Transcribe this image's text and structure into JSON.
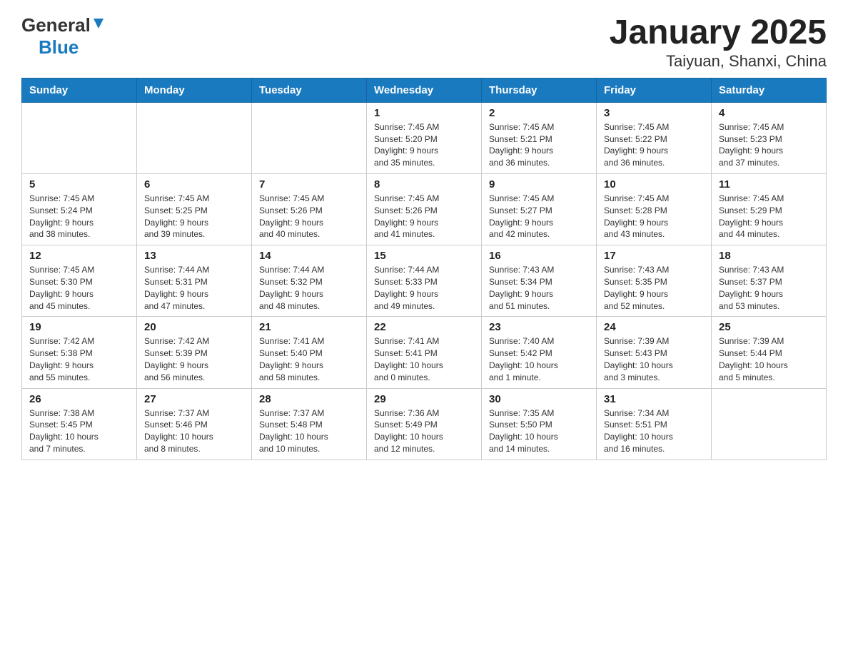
{
  "header": {
    "logo_general": "General",
    "logo_blue": "Blue",
    "title": "January 2025",
    "subtitle": "Taiyuan, Shanxi, China"
  },
  "weekdays": [
    "Sunday",
    "Monday",
    "Tuesday",
    "Wednesday",
    "Thursday",
    "Friday",
    "Saturday"
  ],
  "weeks": [
    [
      {
        "day": "",
        "info": ""
      },
      {
        "day": "",
        "info": ""
      },
      {
        "day": "",
        "info": ""
      },
      {
        "day": "1",
        "info": "Sunrise: 7:45 AM\nSunset: 5:20 PM\nDaylight: 9 hours\nand 35 minutes."
      },
      {
        "day": "2",
        "info": "Sunrise: 7:45 AM\nSunset: 5:21 PM\nDaylight: 9 hours\nand 36 minutes."
      },
      {
        "day": "3",
        "info": "Sunrise: 7:45 AM\nSunset: 5:22 PM\nDaylight: 9 hours\nand 36 minutes."
      },
      {
        "day": "4",
        "info": "Sunrise: 7:45 AM\nSunset: 5:23 PM\nDaylight: 9 hours\nand 37 minutes."
      }
    ],
    [
      {
        "day": "5",
        "info": "Sunrise: 7:45 AM\nSunset: 5:24 PM\nDaylight: 9 hours\nand 38 minutes."
      },
      {
        "day": "6",
        "info": "Sunrise: 7:45 AM\nSunset: 5:25 PM\nDaylight: 9 hours\nand 39 minutes."
      },
      {
        "day": "7",
        "info": "Sunrise: 7:45 AM\nSunset: 5:26 PM\nDaylight: 9 hours\nand 40 minutes."
      },
      {
        "day": "8",
        "info": "Sunrise: 7:45 AM\nSunset: 5:26 PM\nDaylight: 9 hours\nand 41 minutes."
      },
      {
        "day": "9",
        "info": "Sunrise: 7:45 AM\nSunset: 5:27 PM\nDaylight: 9 hours\nand 42 minutes."
      },
      {
        "day": "10",
        "info": "Sunrise: 7:45 AM\nSunset: 5:28 PM\nDaylight: 9 hours\nand 43 minutes."
      },
      {
        "day": "11",
        "info": "Sunrise: 7:45 AM\nSunset: 5:29 PM\nDaylight: 9 hours\nand 44 minutes."
      }
    ],
    [
      {
        "day": "12",
        "info": "Sunrise: 7:45 AM\nSunset: 5:30 PM\nDaylight: 9 hours\nand 45 minutes."
      },
      {
        "day": "13",
        "info": "Sunrise: 7:44 AM\nSunset: 5:31 PM\nDaylight: 9 hours\nand 47 minutes."
      },
      {
        "day": "14",
        "info": "Sunrise: 7:44 AM\nSunset: 5:32 PM\nDaylight: 9 hours\nand 48 minutes."
      },
      {
        "day": "15",
        "info": "Sunrise: 7:44 AM\nSunset: 5:33 PM\nDaylight: 9 hours\nand 49 minutes."
      },
      {
        "day": "16",
        "info": "Sunrise: 7:43 AM\nSunset: 5:34 PM\nDaylight: 9 hours\nand 51 minutes."
      },
      {
        "day": "17",
        "info": "Sunrise: 7:43 AM\nSunset: 5:35 PM\nDaylight: 9 hours\nand 52 minutes."
      },
      {
        "day": "18",
        "info": "Sunrise: 7:43 AM\nSunset: 5:37 PM\nDaylight: 9 hours\nand 53 minutes."
      }
    ],
    [
      {
        "day": "19",
        "info": "Sunrise: 7:42 AM\nSunset: 5:38 PM\nDaylight: 9 hours\nand 55 minutes."
      },
      {
        "day": "20",
        "info": "Sunrise: 7:42 AM\nSunset: 5:39 PM\nDaylight: 9 hours\nand 56 minutes."
      },
      {
        "day": "21",
        "info": "Sunrise: 7:41 AM\nSunset: 5:40 PM\nDaylight: 9 hours\nand 58 minutes."
      },
      {
        "day": "22",
        "info": "Sunrise: 7:41 AM\nSunset: 5:41 PM\nDaylight: 10 hours\nand 0 minutes."
      },
      {
        "day": "23",
        "info": "Sunrise: 7:40 AM\nSunset: 5:42 PM\nDaylight: 10 hours\nand 1 minute."
      },
      {
        "day": "24",
        "info": "Sunrise: 7:39 AM\nSunset: 5:43 PM\nDaylight: 10 hours\nand 3 minutes."
      },
      {
        "day": "25",
        "info": "Sunrise: 7:39 AM\nSunset: 5:44 PM\nDaylight: 10 hours\nand 5 minutes."
      }
    ],
    [
      {
        "day": "26",
        "info": "Sunrise: 7:38 AM\nSunset: 5:45 PM\nDaylight: 10 hours\nand 7 minutes."
      },
      {
        "day": "27",
        "info": "Sunrise: 7:37 AM\nSunset: 5:46 PM\nDaylight: 10 hours\nand 8 minutes."
      },
      {
        "day": "28",
        "info": "Sunrise: 7:37 AM\nSunset: 5:48 PM\nDaylight: 10 hours\nand 10 minutes."
      },
      {
        "day": "29",
        "info": "Sunrise: 7:36 AM\nSunset: 5:49 PM\nDaylight: 10 hours\nand 12 minutes."
      },
      {
        "day": "30",
        "info": "Sunrise: 7:35 AM\nSunset: 5:50 PM\nDaylight: 10 hours\nand 14 minutes."
      },
      {
        "day": "31",
        "info": "Sunrise: 7:34 AM\nSunset: 5:51 PM\nDaylight: 10 hours\nand 16 minutes."
      },
      {
        "day": "",
        "info": ""
      }
    ]
  ]
}
